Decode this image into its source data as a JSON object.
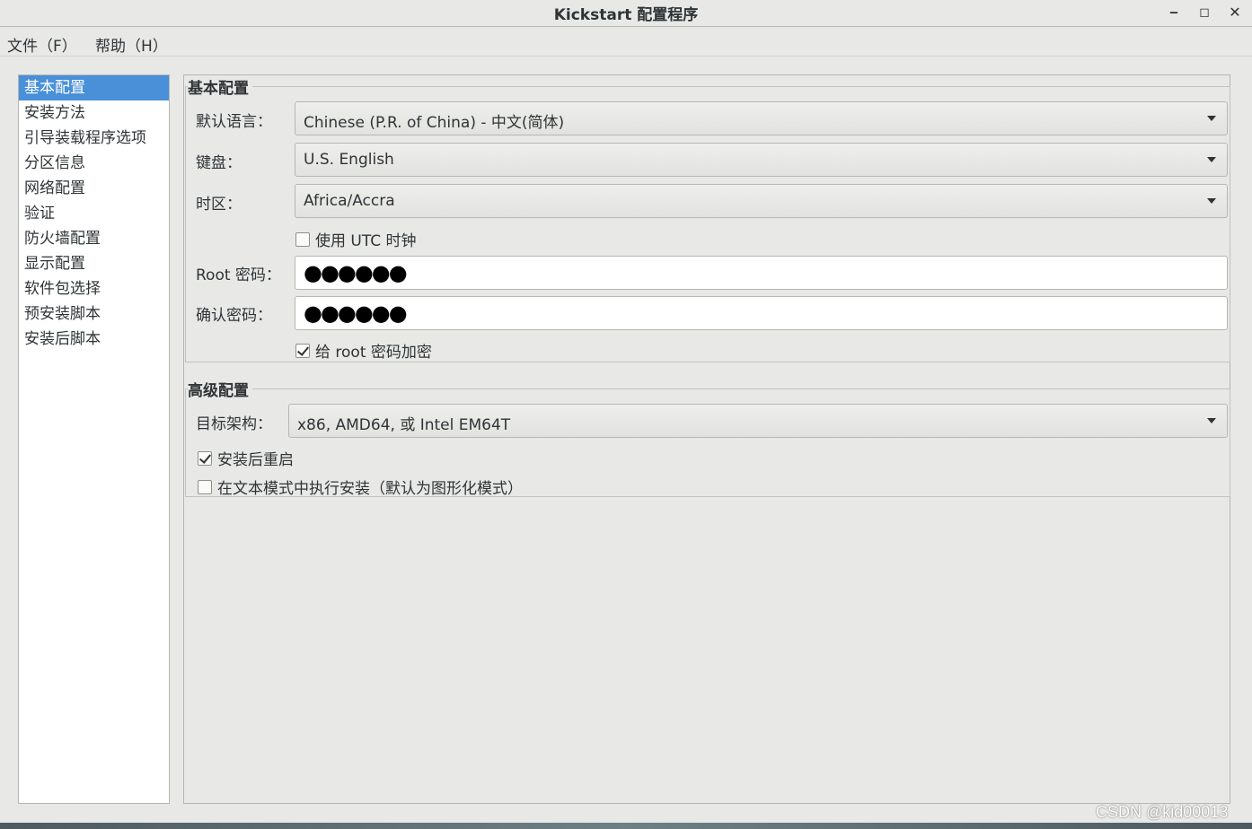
{
  "window": {
    "title": "Kickstart 配置程序",
    "minimize_glyph": "‒",
    "maximize_glyph": "◻",
    "close_glyph": "✕"
  },
  "menubar": {
    "file": "文件（F）",
    "help": "帮助（H）"
  },
  "sidebar": {
    "items": [
      {
        "label": "基本配置",
        "selected": true
      },
      {
        "label": "安装方法"
      },
      {
        "label": "引导装载程序选项"
      },
      {
        "label": "分区信息"
      },
      {
        "label": "网络配置"
      },
      {
        "label": "验证"
      },
      {
        "label": "防火墙配置"
      },
      {
        "label": "显示配置"
      },
      {
        "label": "软件包选择"
      },
      {
        "label": "预安装脚本"
      },
      {
        "label": "安装后脚本"
      }
    ]
  },
  "basic": {
    "section_title": "基本配置",
    "language_label": "默认语言：",
    "language_value": "Chinese (P.R. of China) - 中文(简体)",
    "keyboard_label": "键盘：",
    "keyboard_value": "U.S. English",
    "timezone_label": "时区：",
    "timezone_value": "Africa/Accra",
    "utc_label": "使用 UTC 时钟",
    "utc_checked": false,
    "root_password_label": "Root 密码：",
    "root_password_mask": "●●●●●●",
    "confirm_password_label": "确认密码：",
    "confirm_password_mask": "●●●●●●",
    "encrypt_label": "给 root 密码加密",
    "encrypt_checked": true
  },
  "advanced": {
    "section_title": "高级配置",
    "arch_label": "目标架构：",
    "arch_value": "x86, AMD64, 或 Intel EM64T",
    "reboot_label": "安装后重启",
    "reboot_checked": true,
    "textmode_label": "在文本模式中执行安装（默认为图形化模式）",
    "textmode_checked": false
  },
  "watermark": "CSDN @kid00013",
  "colors": {
    "selection": "#4a90d9",
    "background": "#e8e8e7"
  }
}
